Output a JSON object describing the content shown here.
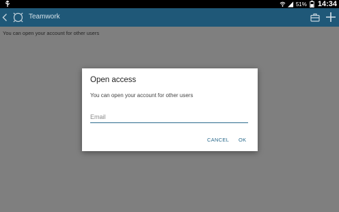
{
  "status_bar": {
    "battery": "51%",
    "time": "14:34"
  },
  "app_bar": {
    "title": "Teamwork",
    "accent_color": "#1f5878"
  },
  "content": {
    "text": "You can open your account for other users"
  },
  "dialog": {
    "title": "Open access",
    "message": "You can open your account for other users",
    "email_placeholder": "Email",
    "cancel_label": "CANCEL",
    "ok_label": "OK",
    "button_color": "#2a6a8c"
  },
  "icons": [
    "usb-icon",
    "wifi-icon",
    "signal-icon",
    "battery-icon",
    "back-icon",
    "app-logo-icon",
    "briefcase-icon",
    "plus-icon"
  ]
}
